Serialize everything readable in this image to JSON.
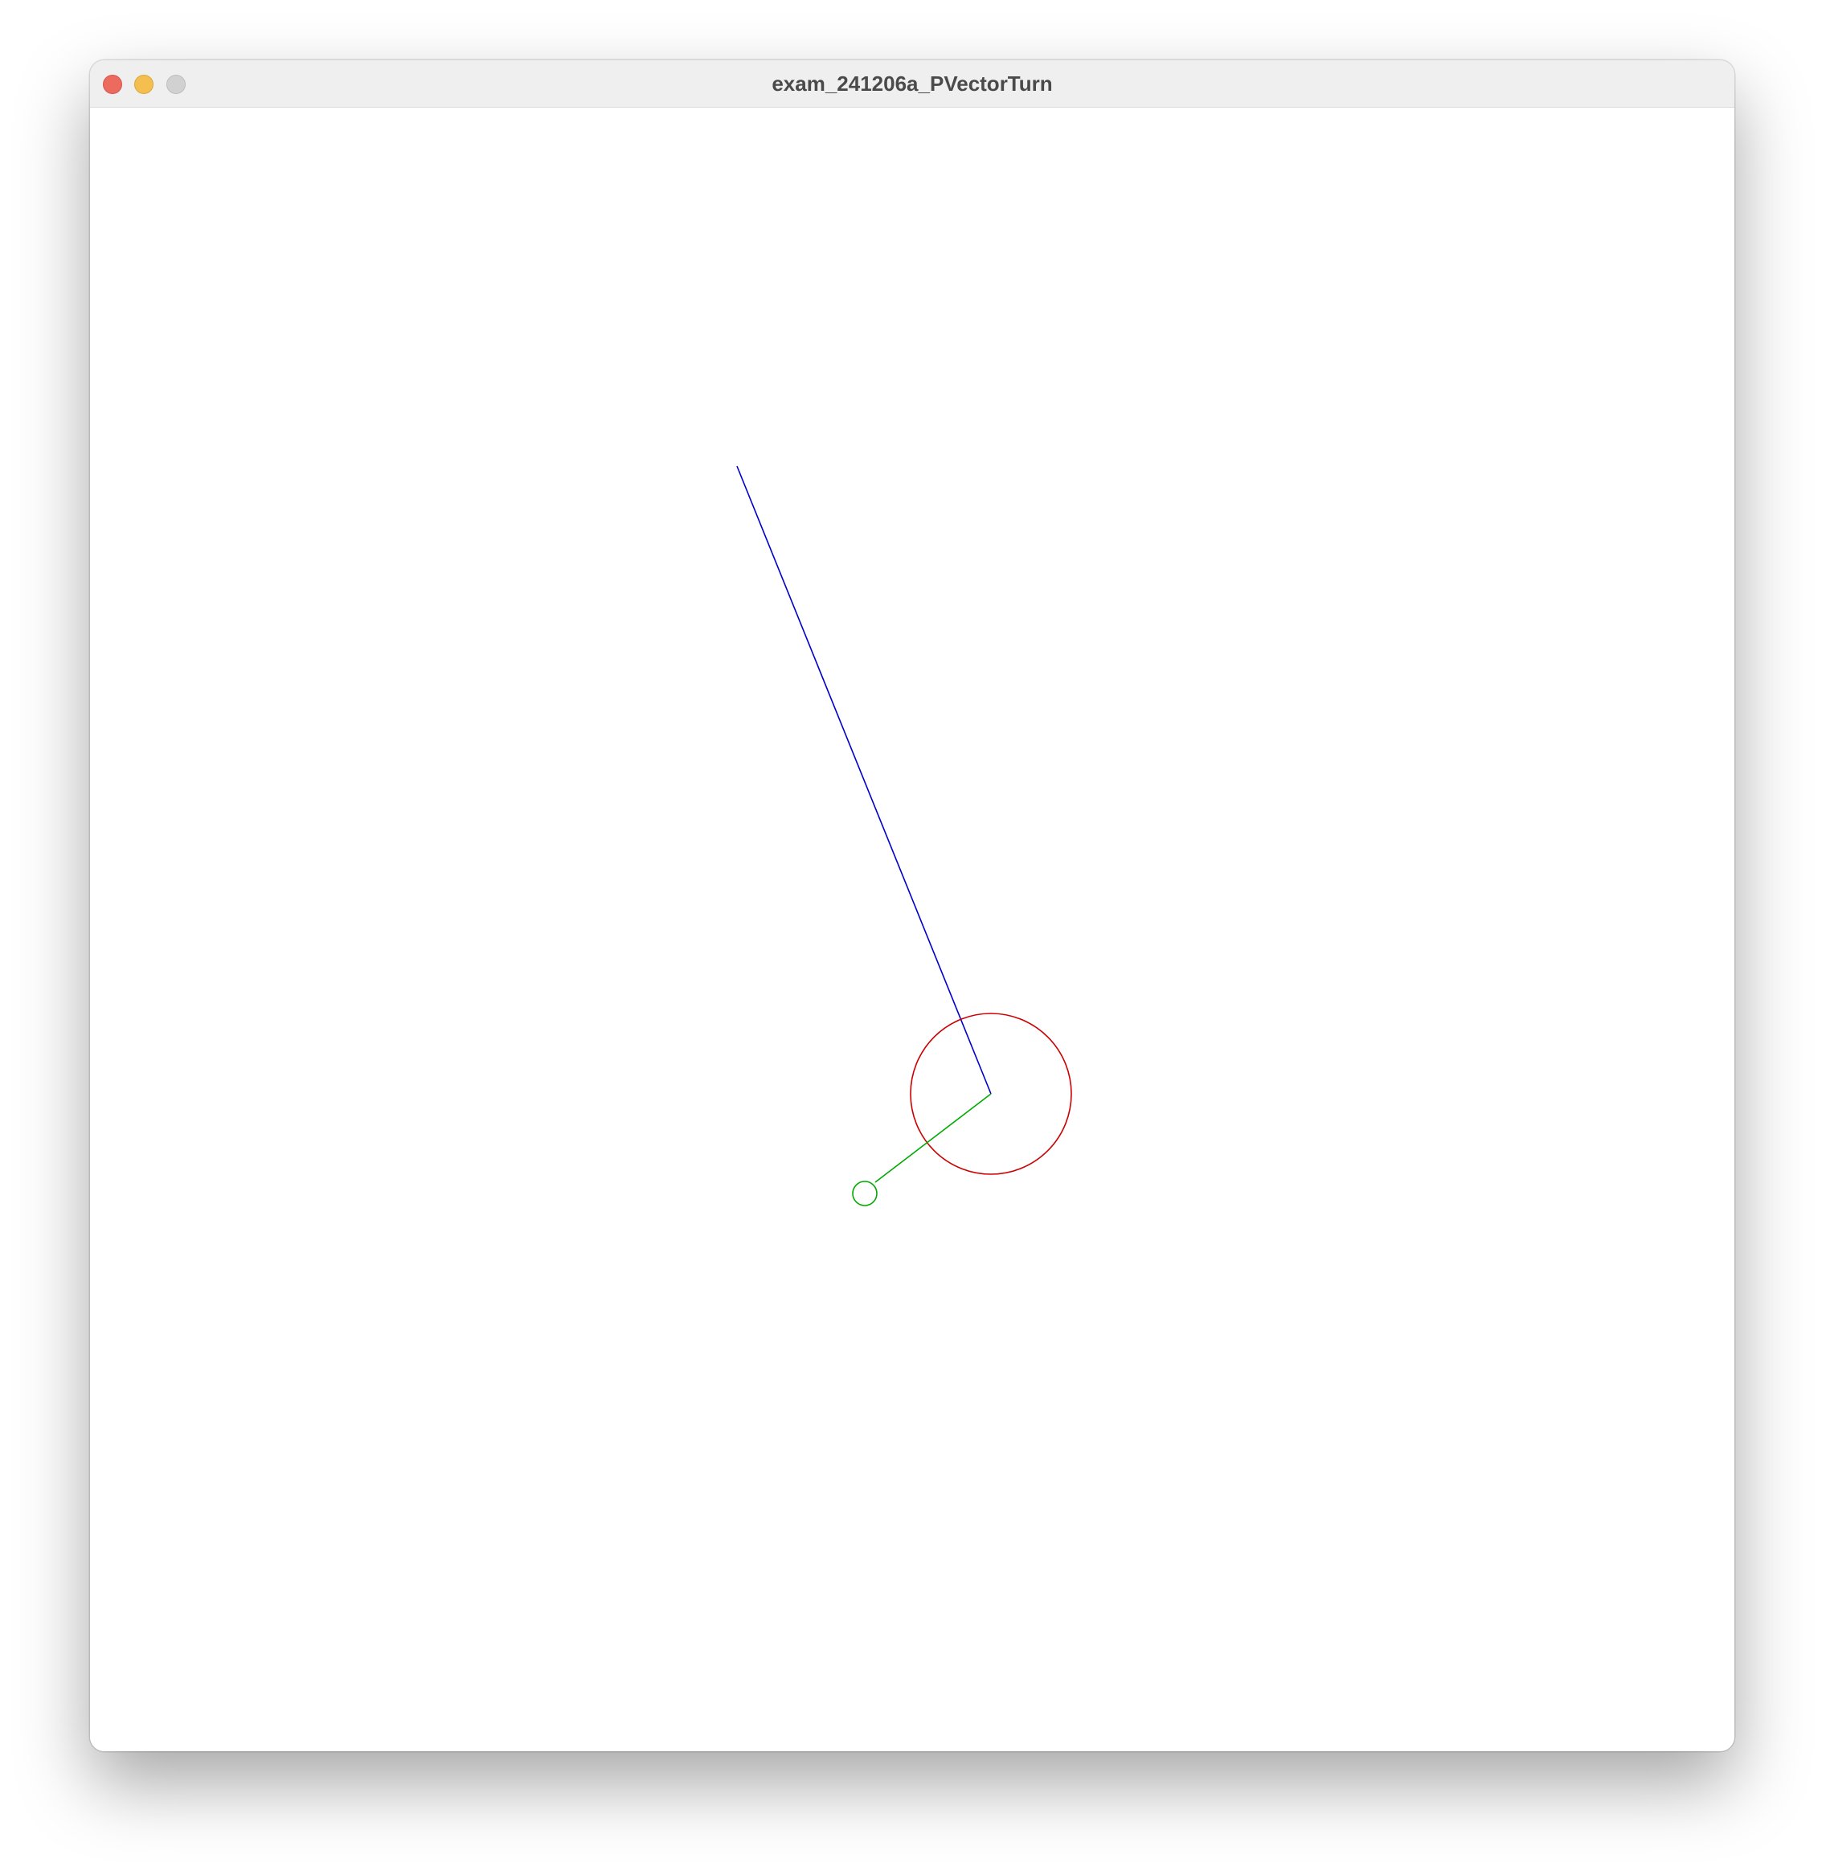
{
  "window": {
    "title": "exam_241206a_PVectorTurn"
  },
  "controls": {
    "close": "close-button",
    "minimize": "minimize-button",
    "zoom": "zoom-button"
  },
  "colors": {
    "titlebar": "#efeff0",
    "canvas": "#ffffff",
    "blue_line": "#0000cc",
    "green_line": "#00aa00",
    "red_circle": "#cc0000"
  }
}
